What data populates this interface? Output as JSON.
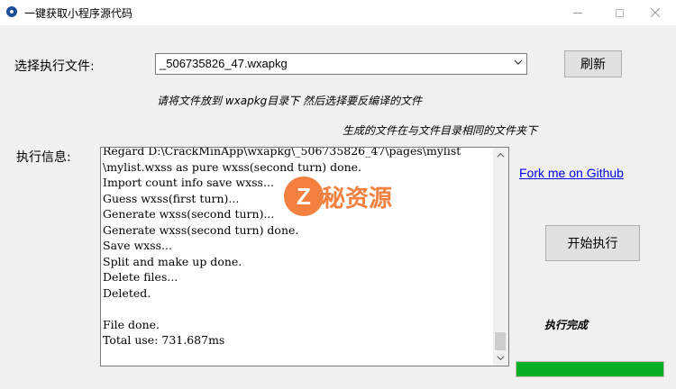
{
  "window": {
    "title": "一键获取小程序源代码",
    "icons": {
      "app": "app-icon",
      "minimize": "minimize-icon",
      "maximize": "maximize-icon",
      "close": "close-icon"
    }
  },
  "file_select": {
    "label": "选择执行文件:",
    "value": "_506735826_47.wxapkg",
    "refresh_label": "刷新"
  },
  "hints": {
    "line1": "请将文件放到 wxapkg目录下 然后选择要反编译的文件",
    "line2": "生成的文件在与文件目录相同的文件夹下"
  },
  "log": {
    "label": "执行信息:",
    "text": "Regard D:\\CrackMinApp\\wxapkg\\_506735826_47\\pages\\mylist\n\\mylist.wxss as pure wxss(second turn) done.\nImport count info save wxss...\nGuess wxss(first turn)...\nGenerate wxss(second turn)...\nGenerate wxss(second turn) done.\nSave wxss...\nSplit and make up done.\nDelete files...\nDeleted.\n\nFile done.\nTotal use: 731.687ms"
  },
  "link": {
    "label": "Fork me on Github"
  },
  "actions": {
    "start_label": "开始执行"
  },
  "status": {
    "text": "执行完成"
  },
  "progress": {
    "percent": 100,
    "color": "#06b025"
  },
  "watermark": {
    "logo_letter": "Z",
    "text": "秘资源"
  }
}
